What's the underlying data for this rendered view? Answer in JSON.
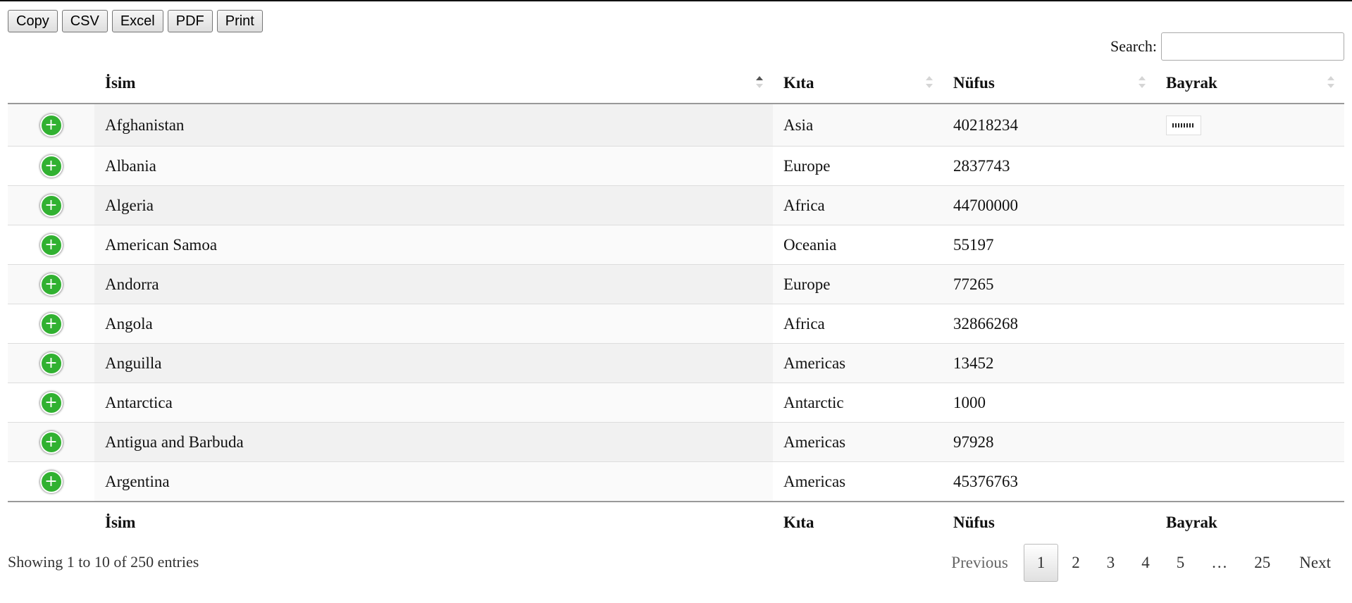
{
  "toolbar": {
    "copy": "Copy",
    "csv": "CSV",
    "excel": "Excel",
    "pdf": "PDF",
    "print": "Print"
  },
  "search": {
    "label": "Search:",
    "value": ""
  },
  "table": {
    "headers": {
      "name": "İsim",
      "continent": "Kıta",
      "population": "Nüfus",
      "flag": "Bayrak"
    },
    "rows": [
      {
        "name": "Afghanistan",
        "continent": "Asia",
        "population": "40218234",
        "flag": "afghanistan-flag-icon"
      },
      {
        "name": "Albania",
        "continent": "Europe",
        "population": "2837743"
      },
      {
        "name": "Algeria",
        "continent": "Africa",
        "population": "44700000"
      },
      {
        "name": "American Samoa",
        "continent": "Oceania",
        "population": "55197"
      },
      {
        "name": "Andorra",
        "continent": "Europe",
        "population": "77265"
      },
      {
        "name": "Angola",
        "continent": "Africa",
        "population": "32866268"
      },
      {
        "name": "Anguilla",
        "continent": "Americas",
        "population": "13452"
      },
      {
        "name": "Antarctica",
        "continent": "Antarctic",
        "population": "1000"
      },
      {
        "name": "Antigua and Barbuda",
        "continent": "Americas",
        "population": "97928"
      },
      {
        "name": "Argentina",
        "continent": "Americas",
        "population": "45376763"
      }
    ]
  },
  "info": "Showing 1 to 10 of 250 entries",
  "pagination": {
    "previous": "Previous",
    "pages": [
      "1",
      "2",
      "3",
      "4",
      "5",
      "…",
      "25"
    ],
    "current": "1",
    "next": "Next"
  }
}
